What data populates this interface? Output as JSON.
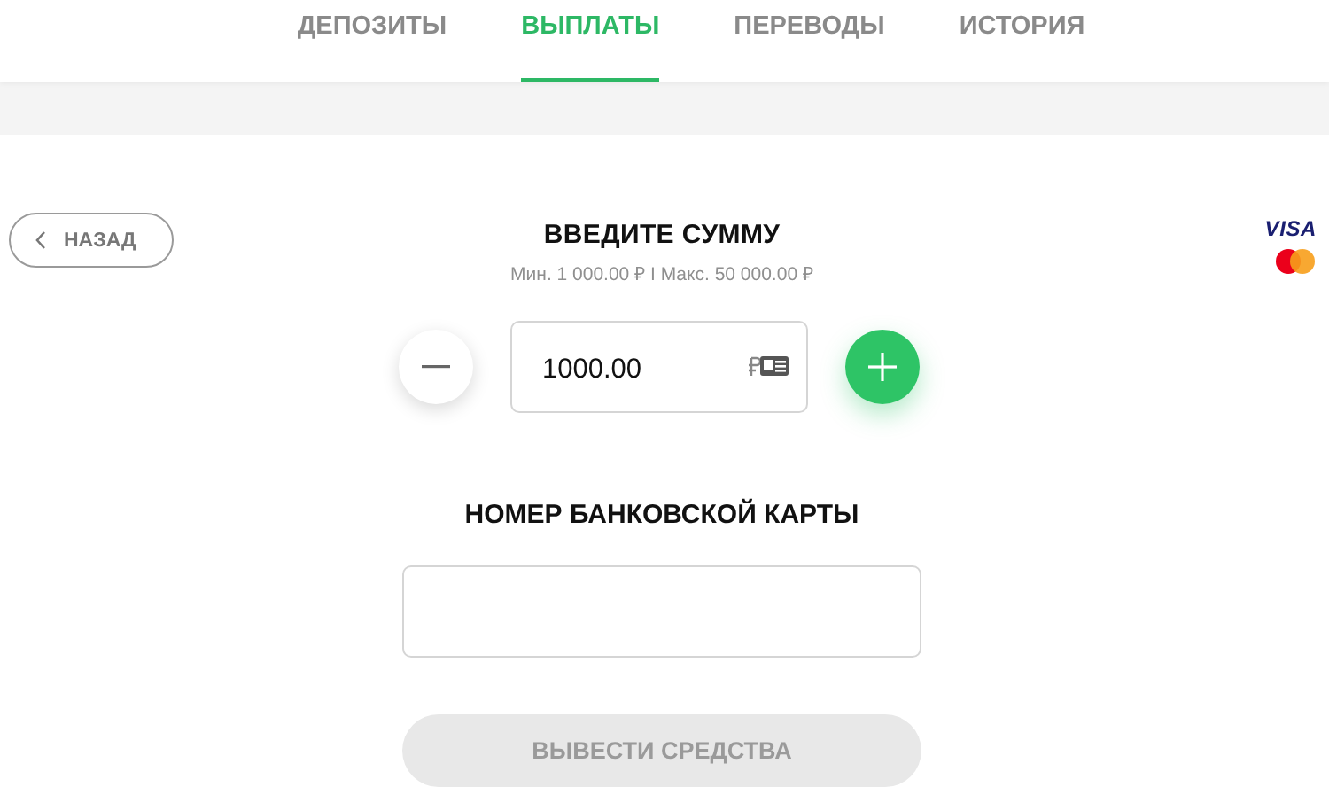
{
  "tabs": [
    {
      "label": "ДЕПОЗИТЫ",
      "selected": false
    },
    {
      "label": "ВЫПЛАТЫ",
      "selected": true
    },
    {
      "label": "ПЕРЕВОДЫ",
      "selected": false
    },
    {
      "label": "ИСТОРИЯ",
      "selected": false
    }
  ],
  "back_button": {
    "label": "НАЗАД"
  },
  "amount": {
    "title": "ВВЕДИТЕ СУММУ",
    "limits": "Мин. 1 000.00 ₽ I Макс. 50 000.00 ₽",
    "value": "1000.00"
  },
  "card": {
    "title": "НОМЕР БАНКОВСКОЙ КАРТЫ"
  },
  "submit_button": {
    "label": "ВЫВЕСТИ СРЕДСТВА",
    "disabled": true
  },
  "payment_logos": {
    "visa": "VISA"
  }
}
